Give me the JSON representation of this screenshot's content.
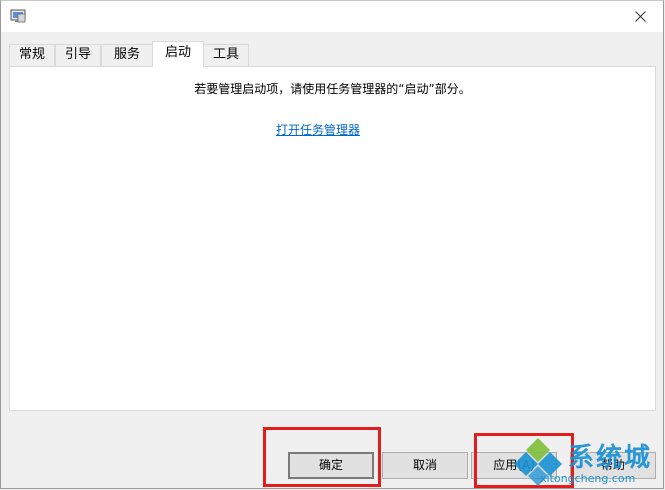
{
  "tabs": [
    {
      "label": "常规",
      "active": false
    },
    {
      "label": "引导",
      "active": false
    },
    {
      "label": "服务",
      "active": false
    },
    {
      "label": "启动",
      "active": true
    },
    {
      "label": "工具",
      "active": false
    }
  ],
  "panel": {
    "message": "若要管理启动项，请使用任务管理器的“启动”部分。",
    "link": "打开任务管理器"
  },
  "buttons": {
    "ok": "确定",
    "cancel": "取消",
    "apply": "应用(A)",
    "help": "帮助"
  },
  "watermark": {
    "name": "系统城",
    "url": "xitongcheng.com"
  },
  "colors": {
    "highlight": "#e41c1c",
    "link": "#0066cc",
    "watermark": "#1a91d4"
  }
}
